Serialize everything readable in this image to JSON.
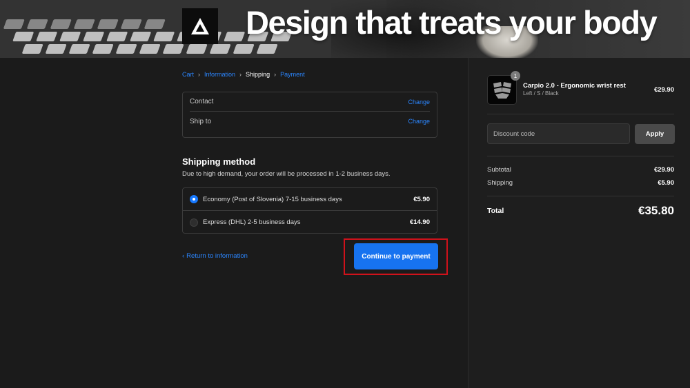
{
  "banner": {
    "headline": "Design that treats your body"
  },
  "breadcrumb": {
    "items": [
      {
        "label": "Cart",
        "state": "link"
      },
      {
        "label": "Information",
        "state": "link"
      },
      {
        "label": "Shipping",
        "state": "current"
      },
      {
        "label": "Payment",
        "state": "link"
      }
    ],
    "separator": "›"
  },
  "review": {
    "contact_label": "Contact",
    "ship_to_label": "Ship to",
    "change_label": "Change"
  },
  "shipping": {
    "title": "Shipping method",
    "note": "Due to high demand, your order will be processed in 1-2 business days.",
    "options": [
      {
        "label": "Economy (Post of Slovenia) 7-15 business days",
        "price": "€5.90",
        "selected": true
      },
      {
        "label": "Express (DHL) 2-5 business days",
        "price": "€14.90",
        "selected": false
      }
    ]
  },
  "actions": {
    "return_label": "Return to information",
    "continue_label": "Continue to payment"
  },
  "sidebar": {
    "product": {
      "quantity": "1",
      "name": "Carpio 2.0 - Ergonomic wrist rest",
      "variant": "Left / S / Black",
      "price": "€29.90"
    },
    "discount": {
      "placeholder": "Discount code",
      "apply_label": "Apply"
    },
    "summary": {
      "subtotal_label": "Subtotal",
      "subtotal_value": "€29.90",
      "shipping_label": "Shipping",
      "shipping_value": "€5.90",
      "total_label": "Total",
      "total_value": "€35.80"
    }
  },
  "colors": {
    "accent": "#1773f0",
    "link": "#2b86ff",
    "highlight": "#d0121b",
    "background": "#1a1a1a"
  }
}
